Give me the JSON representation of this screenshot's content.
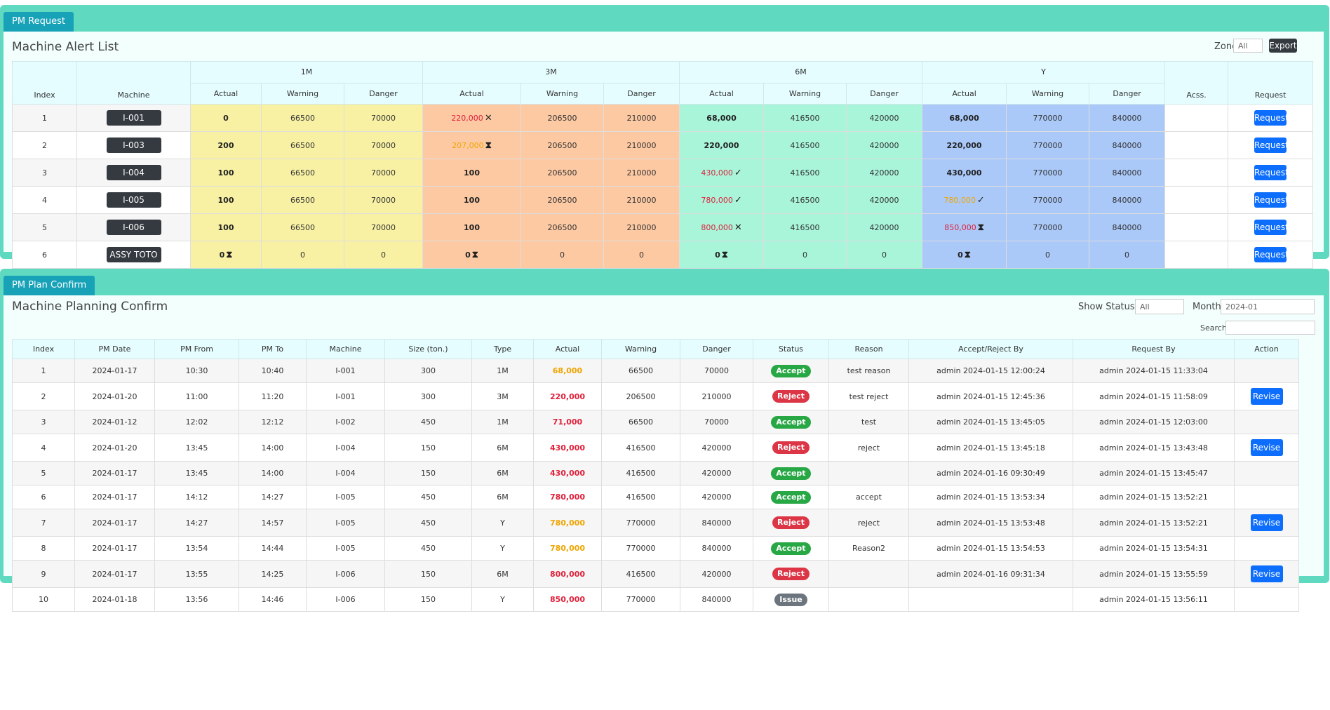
{
  "pm_request": {
    "tab_label": "PM Request",
    "title": "Machine Alert List",
    "zone_label": "Zone",
    "zone_value": "All",
    "export_label": "Export",
    "group_headers": [
      "1M",
      "3M",
      "6M",
      "Y"
    ],
    "headers": {
      "index": "Index",
      "machine": "Machine",
      "actual": "Actual",
      "warning": "Warning",
      "danger": "Danger",
      "acss": "Acss.",
      "request": "Request"
    },
    "rows": [
      {
        "index": "1",
        "machine": "I-001",
        "m1": {
          "actual": "0",
          "actual_color": "#222222",
          "icon": "",
          "warning": "66500",
          "danger": "70000"
        },
        "m3": {
          "actual": "220,000",
          "actual_color": "#e0213b",
          "icon": "✕",
          "warning": "206500",
          "danger": "210000"
        },
        "m6": {
          "actual": "68,000",
          "actual_color": "#222222",
          "icon": "",
          "warning": "416500",
          "danger": "420000"
        },
        "y": {
          "actual": "68,000",
          "actual_color": "#222222",
          "icon": "",
          "warning": "770000",
          "danger": "840000"
        },
        "acss": "",
        "request": "Request"
      },
      {
        "index": "2",
        "machine": "I-003",
        "m1": {
          "actual": "200",
          "actual_color": "#222222",
          "icon": "",
          "warning": "66500",
          "danger": "70000"
        },
        "m3": {
          "actual": "207,000",
          "actual_color": "#f0a500",
          "icon": "⧗",
          "warning": "206500",
          "danger": "210000"
        },
        "m6": {
          "actual": "220,000",
          "actual_color": "#222222",
          "icon": "",
          "warning": "416500",
          "danger": "420000"
        },
        "y": {
          "actual": "220,000",
          "actual_color": "#222222",
          "icon": "",
          "warning": "770000",
          "danger": "840000"
        },
        "acss": "",
        "request": "Request"
      },
      {
        "index": "3",
        "machine": "I-004",
        "m1": {
          "actual": "100",
          "actual_color": "#222222",
          "icon": "",
          "warning": "66500",
          "danger": "70000"
        },
        "m3": {
          "actual": "100",
          "actual_color": "#222222",
          "icon": "",
          "warning": "206500",
          "danger": "210000"
        },
        "m6": {
          "actual": "430,000",
          "actual_color": "#e0213b",
          "icon": "✓",
          "warning": "416500",
          "danger": "420000"
        },
        "y": {
          "actual": "430,000",
          "actual_color": "#222222",
          "icon": "",
          "warning": "770000",
          "danger": "840000"
        },
        "acss": "",
        "request": "Request"
      },
      {
        "index": "4",
        "machine": "I-005",
        "m1": {
          "actual": "100",
          "actual_color": "#222222",
          "icon": "",
          "warning": "66500",
          "danger": "70000"
        },
        "m3": {
          "actual": "100",
          "actual_color": "#222222",
          "icon": "",
          "warning": "206500",
          "danger": "210000"
        },
        "m6": {
          "actual": "780,000",
          "actual_color": "#e0213b",
          "icon": "✓",
          "warning": "416500",
          "danger": "420000"
        },
        "y": {
          "actual": "780,000",
          "actual_color": "#f0a500",
          "icon": "✓",
          "warning": "770000",
          "danger": "840000"
        },
        "acss": "",
        "request": "Request"
      },
      {
        "index": "5",
        "machine": "I-006",
        "m1": {
          "actual": "100",
          "actual_color": "#222222",
          "icon": "",
          "warning": "66500",
          "danger": "70000"
        },
        "m3": {
          "actual": "100",
          "actual_color": "#222222",
          "icon": "",
          "warning": "206500",
          "danger": "210000"
        },
        "m6": {
          "actual": "800,000",
          "actual_color": "#e0213b",
          "icon": "✕",
          "warning": "416500",
          "danger": "420000"
        },
        "y": {
          "actual": "850,000",
          "actual_color": "#e0213b",
          "icon": "⧗",
          "warning": "770000",
          "danger": "840000"
        },
        "acss": "",
        "request": "Request"
      },
      {
        "index": "6",
        "machine": "ASSY TOTO",
        "m1": {
          "actual": "0",
          "actual_color": "#222222",
          "icon": "⧗",
          "warning": "0",
          "danger": "0"
        },
        "m3": {
          "actual": "0",
          "actual_color": "#222222",
          "icon": "⧗",
          "warning": "0",
          "danger": "0"
        },
        "m6": {
          "actual": "0",
          "actual_color": "#222222",
          "icon": "⧗",
          "warning": "0",
          "danger": "0"
        },
        "y": {
          "actual": "0",
          "actual_color": "#222222",
          "icon": "⧗",
          "warning": "0",
          "danger": "0"
        },
        "acss": "",
        "request": "Request"
      }
    ]
  },
  "pm_plan": {
    "tab_label": "PM Plan Confirm",
    "title": "Machine Planning Confirm",
    "show_status_label": "Show Status:",
    "show_status_value": "All",
    "month_label": "Month",
    "month_value": "2024-01",
    "search_label": "Search:",
    "headers": [
      "Index",
      "PM Date",
      "PM From",
      "PM To",
      "Machine",
      "Size (ton.)",
      "Type",
      "Actual",
      "Warning",
      "Danger",
      "Status",
      "Reason",
      "Accept/Reject By",
      "Request By",
      "Action"
    ],
    "status_colors": {
      "Accept": "#28a745",
      "Reject": "#dc3545",
      "Issue": "#6c757d"
    },
    "rows": [
      {
        "index": "1",
        "pm_date": "2024-01-17",
        "pm_from": "10:30",
        "pm_to": "10:40",
        "machine": "I-001",
        "size": "300",
        "type": "1M",
        "actual": "68,000",
        "actual_color": "#f0a500",
        "warning": "66500",
        "danger": "70000",
        "status": "Accept",
        "reason": "test reason",
        "accept_by": "admin 2024-01-15 12:00:24",
        "request_by": "admin 2024-01-15 11:33:04",
        "action": ""
      },
      {
        "index": "2",
        "pm_date": "2024-01-20",
        "pm_from": "11:00",
        "pm_to": "11:20",
        "machine": "I-001",
        "size": "300",
        "type": "3M",
        "actual": "220,000",
        "actual_color": "#e0213b",
        "warning": "206500",
        "danger": "210000",
        "status": "Reject",
        "reason": "test reject",
        "accept_by": "admin 2024-01-15 12:45:36",
        "request_by": "admin 2024-01-15 11:58:09",
        "action": "Revise"
      },
      {
        "index": "3",
        "pm_date": "2024-01-12",
        "pm_from": "12:02",
        "pm_to": "12:12",
        "machine": "I-002",
        "size": "450",
        "type": "1M",
        "actual": "71,000",
        "actual_color": "#e0213b",
        "warning": "66500",
        "danger": "70000",
        "status": "Accept",
        "reason": "test",
        "accept_by": "admin 2024-01-15 13:45:05",
        "request_by": "admin 2024-01-15 12:03:00",
        "action": ""
      },
      {
        "index": "4",
        "pm_date": "2024-01-20",
        "pm_from": "13:45",
        "pm_to": "14:00",
        "machine": "I-004",
        "size": "150",
        "type": "6M",
        "actual": "430,000",
        "actual_color": "#e0213b",
        "warning": "416500",
        "danger": "420000",
        "status": "Reject",
        "reason": "reject",
        "accept_by": "admin 2024-01-15 13:45:18",
        "request_by": "admin 2024-01-15 13:43:48",
        "action": "Revise"
      },
      {
        "index": "5",
        "pm_date": "2024-01-17",
        "pm_from": "13:45",
        "pm_to": "14:00",
        "machine": "I-004",
        "size": "150",
        "type": "6M",
        "actual": "430,000",
        "actual_color": "#e0213b",
        "warning": "416500",
        "danger": "420000",
        "status": "Accept",
        "reason": "",
        "accept_by": "admin 2024-01-16 09:30:49",
        "request_by": "admin 2024-01-15 13:45:47",
        "action": ""
      },
      {
        "index": "6",
        "pm_date": "2024-01-17",
        "pm_from": "14:12",
        "pm_to": "14:27",
        "machine": "I-005",
        "size": "450",
        "type": "6M",
        "actual": "780,000",
        "actual_color": "#e0213b",
        "warning": "416500",
        "danger": "420000",
        "status": "Accept",
        "reason": "accept",
        "accept_by": "admin 2024-01-15 13:53:34",
        "request_by": "admin 2024-01-15 13:52:21",
        "action": ""
      },
      {
        "index": "7",
        "pm_date": "2024-01-17",
        "pm_from": "14:27",
        "pm_to": "14:57",
        "machine": "I-005",
        "size": "450",
        "type": "Y",
        "actual": "780,000",
        "actual_color": "#f0a500",
        "warning": "770000",
        "danger": "840000",
        "status": "Reject",
        "reason": "reject",
        "accept_by": "admin 2024-01-15 13:53:48",
        "request_by": "admin 2024-01-15 13:52:21",
        "action": "Revise"
      },
      {
        "index": "8",
        "pm_date": "2024-01-17",
        "pm_from": "13:54",
        "pm_to": "14:44",
        "machine": "I-005",
        "size": "450",
        "type": "Y",
        "actual": "780,000",
        "actual_color": "#f0a500",
        "warning": "770000",
        "danger": "840000",
        "status": "Accept",
        "reason": "Reason2",
        "accept_by": "admin 2024-01-15 13:54:53",
        "request_by": "admin 2024-01-15 13:54:31",
        "action": ""
      },
      {
        "index": "9",
        "pm_date": "2024-01-17",
        "pm_from": "13:55",
        "pm_to": "14:25",
        "machine": "I-006",
        "size": "150",
        "type": "6M",
        "actual": "800,000",
        "actual_color": "#e0213b",
        "warning": "416500",
        "danger": "420000",
        "status": "Reject",
        "reason": "",
        "accept_by": "admin 2024-01-16 09:31:34",
        "request_by": "admin 2024-01-15 13:55:59",
        "action": "Revise"
      },
      {
        "index": "10",
        "pm_date": "2024-01-18",
        "pm_from": "13:56",
        "pm_to": "14:46",
        "machine": "I-006",
        "size": "150",
        "type": "Y",
        "actual": "850,000",
        "actual_color": "#e0213b",
        "warning": "770000",
        "danger": "840000",
        "status": "Issue",
        "reason": "",
        "accept_by": "",
        "request_by": "admin 2024-01-15 13:56:11",
        "action": ""
      }
    ]
  }
}
